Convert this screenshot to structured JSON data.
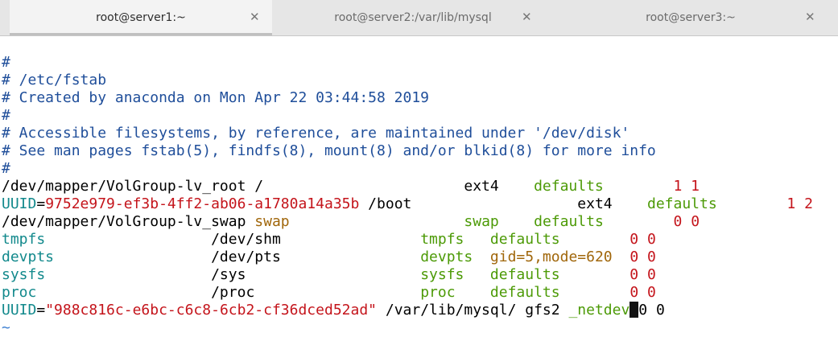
{
  "tabs": [
    {
      "label": "root@server1:~",
      "active": true
    },
    {
      "label": "root@server2:/var/lib/mysql",
      "active": false
    },
    {
      "label": "root@server3:~",
      "active": false
    }
  ],
  "close_glyph": "✕",
  "colors": {
    "comment": "#1f4e9a",
    "teal": "#12898c",
    "green": "#4c9a06",
    "red": "#c4141b",
    "orange": "#a0660a"
  },
  "lines": [
    [
      {
        "t": "#",
        "c": "c"
      }
    ],
    [
      {
        "t": "# /etc/fstab",
        "c": "c"
      }
    ],
    [
      {
        "t": "# Created by anaconda on Mon Apr 22 03:44:58 2019",
        "c": "c"
      }
    ],
    [
      {
        "t": "#",
        "c": "c"
      }
    ],
    [
      {
        "t": "# Accessible filesystems, by reference, are maintained under '/dev/disk'",
        "c": "c"
      }
    ],
    [
      {
        "t": "# See man pages fstab(5), findfs(8), mount(8) and/or blkid(8) for more info",
        "c": "c"
      }
    ],
    [
      {
        "t": "#",
        "c": "c"
      }
    ],
    [
      {
        "t": "/dev/mapper/VolGroup-lv_root /                       ",
        "c": ""
      },
      {
        "t": "ext4",
        "c": ""
      },
      {
        "t": "    ",
        "c": ""
      },
      {
        "t": "defaults",
        "c": "g"
      },
      {
        "t": "        ",
        "c": ""
      },
      {
        "t": "1 1",
        "c": "r"
      }
    ],
    [
      {
        "t": "UUID",
        "c": "t"
      },
      {
        "t": "=",
        "c": ""
      },
      {
        "t": "9752e979-ef3b-4ff2-ab06-a1780a14a35b",
        "c": "r"
      },
      {
        "t": " /boot                   ",
        "c": ""
      },
      {
        "t": "ext4",
        "c": ""
      },
      {
        "t": "    ",
        "c": ""
      },
      {
        "t": "defaults",
        "c": "g"
      },
      {
        "t": "        ",
        "c": ""
      },
      {
        "t": "1 2",
        "c": "r"
      }
    ],
    [
      {
        "t": "/dev/mapper/VolGroup-lv_swap ",
        "c": ""
      },
      {
        "t": "swap",
        "c": "o"
      },
      {
        "t": "                    ",
        "c": ""
      },
      {
        "t": "swap",
        "c": "g"
      },
      {
        "t": "    ",
        "c": ""
      },
      {
        "t": "defaults",
        "c": "g"
      },
      {
        "t": "        ",
        "c": ""
      },
      {
        "t": "0 0",
        "c": "r"
      }
    ],
    [
      {
        "t": "tmpfs",
        "c": "t"
      },
      {
        "t": "                   /dev/shm                ",
        "c": ""
      },
      {
        "t": "tmpfs",
        "c": "g"
      },
      {
        "t": "   ",
        "c": ""
      },
      {
        "t": "defaults",
        "c": "g"
      },
      {
        "t": "        ",
        "c": ""
      },
      {
        "t": "0 0",
        "c": "r"
      }
    ],
    [
      {
        "t": "devpts",
        "c": "t"
      },
      {
        "t": "                  /dev/pts                ",
        "c": ""
      },
      {
        "t": "devpts",
        "c": "g"
      },
      {
        "t": "  ",
        "c": ""
      },
      {
        "t": "gid=5,mode=620",
        "c": "o"
      },
      {
        "t": "  ",
        "c": ""
      },
      {
        "t": "0 0",
        "c": "r"
      }
    ],
    [
      {
        "t": "sysfs",
        "c": "t"
      },
      {
        "t": "                   /sys                    ",
        "c": ""
      },
      {
        "t": "sysfs",
        "c": "g"
      },
      {
        "t": "   ",
        "c": ""
      },
      {
        "t": "defaults",
        "c": "g"
      },
      {
        "t": "        ",
        "c": ""
      },
      {
        "t": "0 0",
        "c": "r"
      }
    ],
    [
      {
        "t": "proc",
        "c": "t"
      },
      {
        "t": "                    /proc                   ",
        "c": ""
      },
      {
        "t": "proc",
        "c": "g"
      },
      {
        "t": "    ",
        "c": ""
      },
      {
        "t": "defaults",
        "c": "g"
      },
      {
        "t": "        ",
        "c": ""
      },
      {
        "t": "0 0",
        "c": "r"
      }
    ],
    [
      {
        "t": "UUID",
        "c": "t"
      },
      {
        "t": "=",
        "c": ""
      },
      {
        "t": "\"988c816c-e6bc-c6c8-6cb2-cf36dced52ad\"",
        "c": "r"
      },
      {
        "t": " /var/lib/mysql/ gfs2 ",
        "c": ""
      },
      {
        "t": "_netdev",
        "c": "g"
      },
      {
        "t": " ",
        "c": "cursor"
      },
      {
        "t": "0 0",
        "c": ""
      }
    ],
    [
      {
        "t": "~",
        "c": "tl"
      }
    ]
  ]
}
